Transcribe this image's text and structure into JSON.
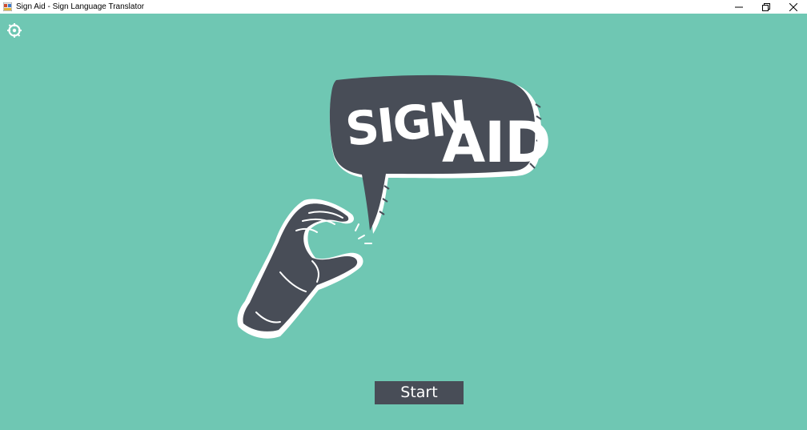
{
  "window": {
    "title": "Sign Aid - Sign Language Translator",
    "controls": {
      "minimize": "minimize-icon",
      "maximize": "restore-icon",
      "close": "close-icon"
    }
  },
  "logo": {
    "line1": "SIGN",
    "line2": "AID"
  },
  "start_button": {
    "label": "Start"
  },
  "colors": {
    "background": "#6fc7b3",
    "accent_dark": "#484d57",
    "white": "#ffffff"
  }
}
